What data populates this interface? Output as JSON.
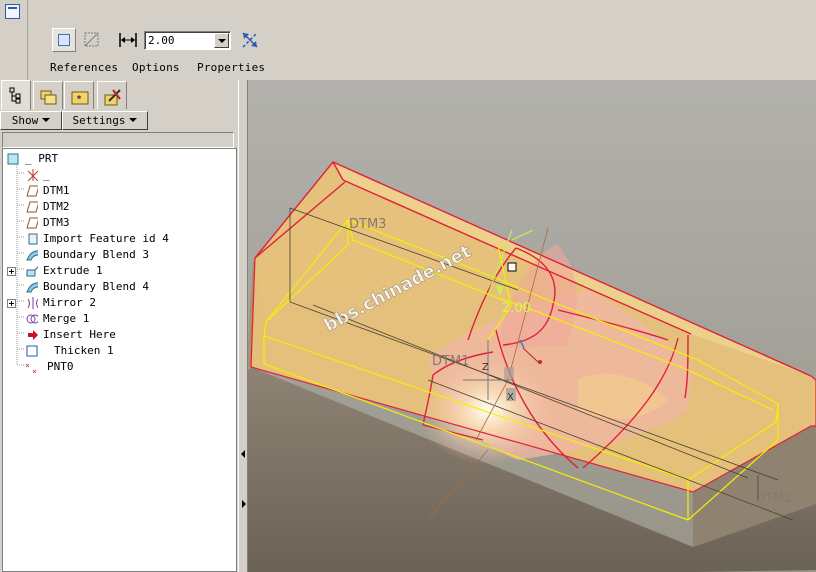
{
  "dashboard": {
    "thickness_value": "2.00",
    "tabs": [
      "References",
      "Options",
      "Properties"
    ]
  },
  "panel": {
    "show_label": "Show",
    "settings_label": "Settings",
    "tree": [
      {
        "label": "_ PRT",
        "icon": "part-icon"
      },
      {
        "label": "_",
        "icon": "csys-icon"
      },
      {
        "label": "DTM1",
        "icon": "datum-plane-icon"
      },
      {
        "label": "DTM2",
        "icon": "datum-plane-icon"
      },
      {
        "label": "DTM3",
        "icon": "datum-plane-icon"
      },
      {
        "label": "Import Feature id 4",
        "icon": "import-feature-icon"
      },
      {
        "label": "Boundary Blend 3",
        "icon": "boundary-blend-icon"
      },
      {
        "label": "Extrude 1",
        "icon": "extrude-icon"
      },
      {
        "label": "Boundary Blend 4",
        "icon": "boundary-blend-icon"
      },
      {
        "label": "Mirror 2",
        "icon": "mirror-icon"
      },
      {
        "label": "Merge 1",
        "icon": "merge-icon"
      },
      {
        "label": "Insert Here",
        "icon": "insert-arrow-icon"
      },
      {
        "label": "Thicken 1",
        "icon": "thicken-icon"
      },
      {
        "label": "PNT0",
        "icon": "datum-point-icon"
      }
    ]
  },
  "graphics": {
    "dimension_label": "2.00",
    "watermark": "bbs.chinade.net",
    "datum_labels": {
      "dtm1": "DTM1",
      "dtm2": "DTM2",
      "dtm3": "DTM3"
    },
    "axis_labels": {
      "z": "Z",
      "x": "X"
    }
  },
  "colors": {
    "part_fill": "#e8c27a",
    "edge_red": "#e0203a",
    "edge_yellow": "#f5f000",
    "dim_green": "#c6ef52"
  }
}
